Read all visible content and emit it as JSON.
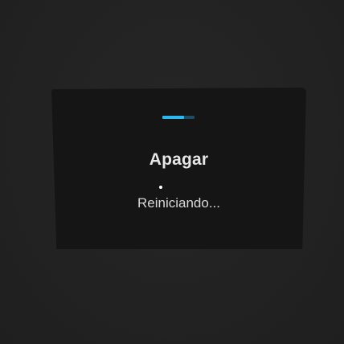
{
  "dialog": {
    "title": "Apagar",
    "status": "Reiniciando...",
    "progress": 0.68
  },
  "colors": {
    "background": "#222222",
    "dialog": "#151515",
    "progress_fill": "#2eb6ee",
    "progress_track": "#1e4c62",
    "text": "#e6e6e6"
  }
}
